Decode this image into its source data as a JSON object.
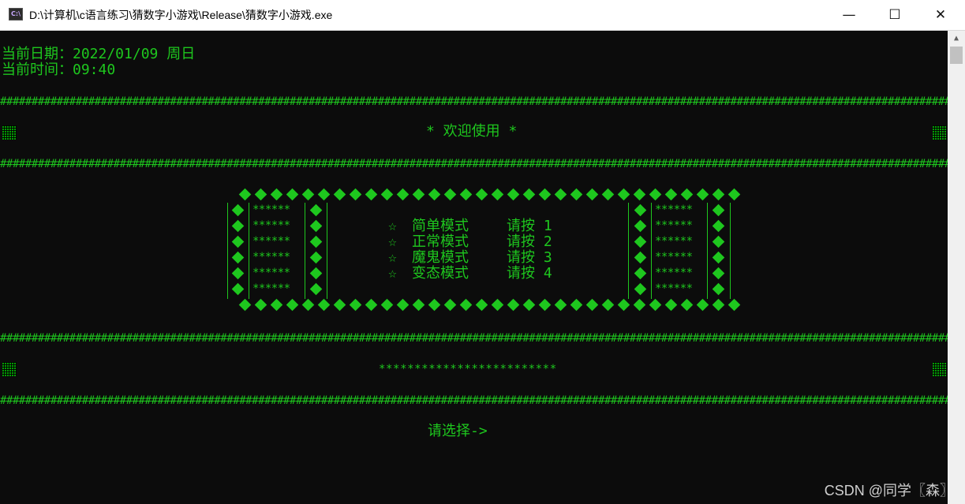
{
  "window": {
    "title": "D:\\计算机\\c语言练习\\猜数字小游戏\\Release\\猜数字小游戏.exe",
    "icon": "console-app-icon",
    "minimize_glyph": "—",
    "maximize_glyph": "☐",
    "close_glyph": "✕"
  },
  "console": {
    "date_line": "当前日期：2022/01/09 周日",
    "time_line": "当前时间：09:40",
    "welcome": "* 欢迎使用 *",
    "banner_stars": "*************************",
    "stars_cell": "******",
    "menu": [
      {
        "star": "☆",
        "label": "简单模式",
        "hint": "请按 1"
      },
      {
        "star": "☆",
        "label": "正常模式",
        "hint": "请按 2"
      },
      {
        "star": "☆",
        "label": "魔鬼模式",
        "hint": "请按 3"
      },
      {
        "star": "☆",
        "label": "变态模式",
        "hint": "请按 4"
      }
    ],
    "prompt": "请选择->",
    "text_color": "#1ec71e",
    "background": "#0c0c0c"
  },
  "watermark": "CSDN @同学〖森〗"
}
